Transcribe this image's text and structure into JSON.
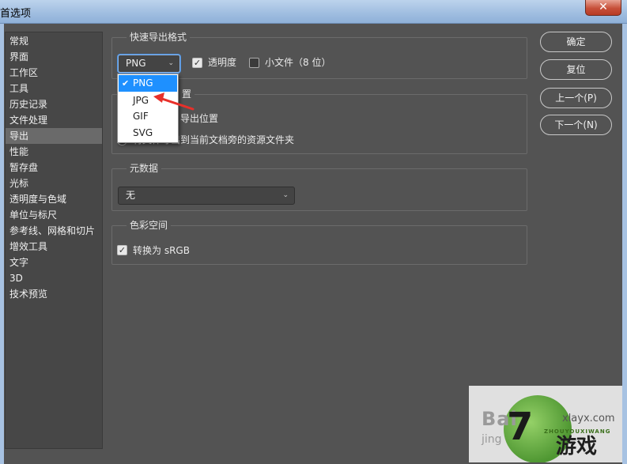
{
  "window": {
    "title": "首选项",
    "close_glyph": "✕"
  },
  "sidebar": {
    "items": [
      {
        "label": "常规"
      },
      {
        "label": "界面"
      },
      {
        "label": "工作区"
      },
      {
        "label": "工具"
      },
      {
        "label": "历史记录"
      },
      {
        "label": "文件处理"
      },
      {
        "label": "导出",
        "selected": true
      },
      {
        "label": "性能"
      },
      {
        "label": "暂存盘"
      },
      {
        "label": "光标"
      },
      {
        "label": "透明度与色域"
      },
      {
        "label": "单位与标尺"
      },
      {
        "label": "参考线、网格和切片"
      },
      {
        "label": "增效工具"
      },
      {
        "label": "文字"
      },
      {
        "label": "3D"
      },
      {
        "label": "技术预览"
      }
    ]
  },
  "quick_export": {
    "group_label": "快速导出格式",
    "format_value": "PNG",
    "format_options": [
      "PNG",
      "JPG",
      "GIF",
      "SVG"
    ],
    "transparency_label": "透明度",
    "transparency_checked": true,
    "small_file_label": "小文件（8 位）",
    "small_file_checked": false
  },
  "export_location": {
    "group_label_partial": "置",
    "option1_partial": "导出位置",
    "option2_partial": "将文件导出到当前文档旁的资源文件夹"
  },
  "metadata": {
    "group_label": "元数据",
    "value": "无"
  },
  "color_space": {
    "group_label": "色彩空间",
    "convert_label": "转换为 sRGB",
    "convert_checked": true
  },
  "buttons": {
    "ok": "确定",
    "reset": "复位",
    "prev": "上一个(P)",
    "next": "下一个(N)"
  },
  "watermark": {
    "bai": "Bai",
    "jing": "jing",
    "domain": "xlayx.com",
    "sub": "ZHOUYOUXIWANG",
    "main": "游戏",
    "big": "7"
  },
  "colors": {
    "panel_bg": "#535353",
    "sidebar_bg": "#474747",
    "selected_item": "#6a6a6a",
    "menu_highlight": "#1e90ff",
    "annotation_arrow": "#e8302a"
  }
}
